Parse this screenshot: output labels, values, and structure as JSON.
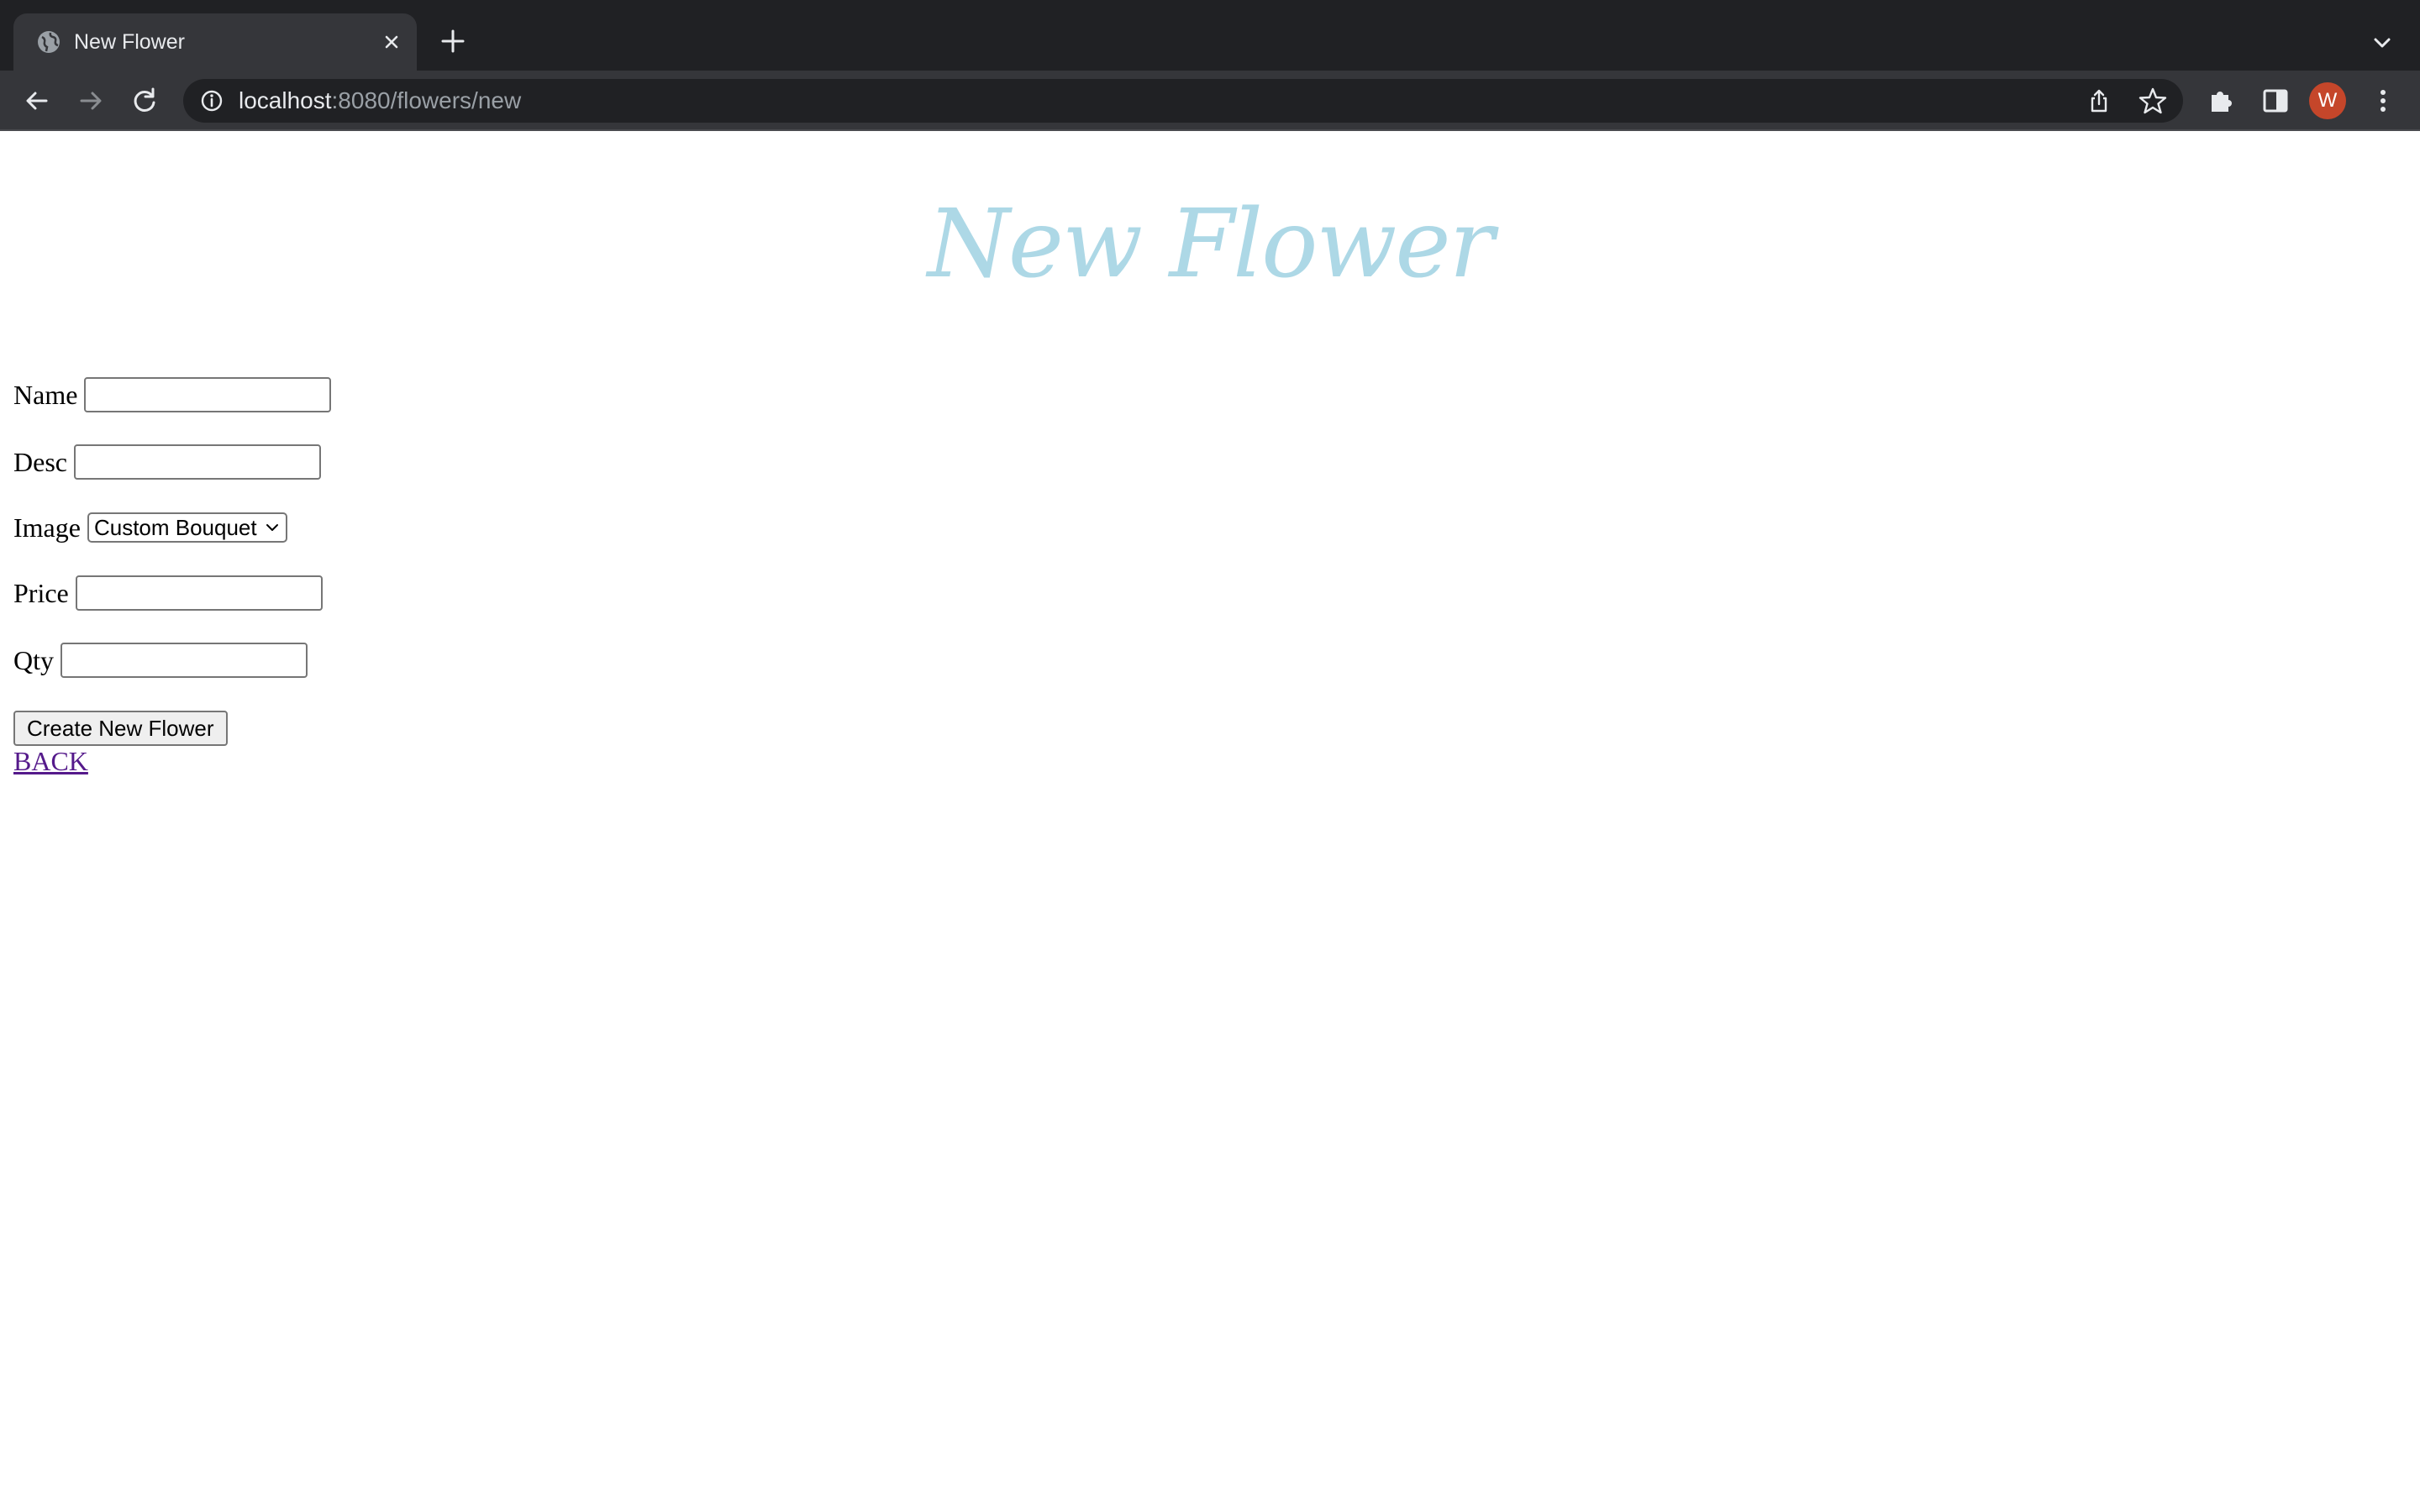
{
  "browser": {
    "tab_title": "New Flower",
    "url_host": "localhost",
    "url_path": ":8080/flowers/new",
    "avatar_letter": "W",
    "avatar_color": "#c5462a"
  },
  "page": {
    "title": "New Flower",
    "title_color": "#add8e6",
    "form": {
      "name_label": "Name",
      "name_value": "",
      "desc_label": "Desc",
      "desc_value": "",
      "image_label": "Image",
      "image_selected": "Custom Bouquet",
      "price_label": "Price",
      "price_value": "",
      "qty_label": "Qty",
      "qty_value": "",
      "submit_label": "Create New Flower"
    },
    "back_link": "BACK"
  }
}
